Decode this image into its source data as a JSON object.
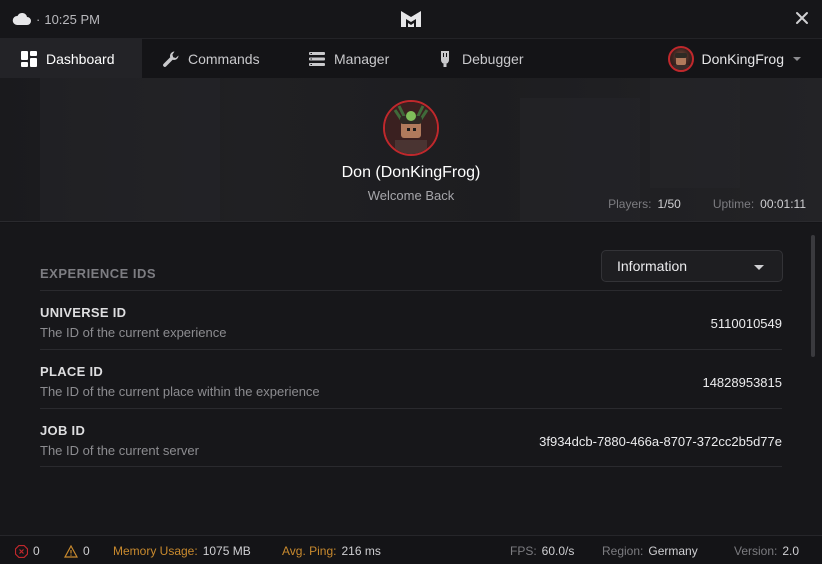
{
  "titlebar": {
    "time": "10:25 PM",
    "icons": {
      "weather": "cloud-icon",
      "logo": "logo-icon",
      "close": "close-icon"
    }
  },
  "nav": {
    "tabs": [
      {
        "label": "Dashboard",
        "icon": "dashboard-icon",
        "active": true
      },
      {
        "label": "Commands",
        "icon": "wrench-icon",
        "active": false
      },
      {
        "label": "Manager",
        "icon": "list-icon",
        "active": false
      },
      {
        "label": "Debugger",
        "icon": "debugger-icon",
        "active": false
      }
    ],
    "user": {
      "name": "DonKingFrog",
      "icon": "chevron-down-icon"
    }
  },
  "hero": {
    "display_name": "Don (DonKingFrog)",
    "welcome": "Welcome Back",
    "players_label": "Players:",
    "players_value": "1/50",
    "uptime_label": "Uptime:",
    "uptime_value": "00:01:11"
  },
  "main": {
    "section_title": "EXPERIENCE IDS",
    "dropdown": {
      "selected": "Information"
    },
    "rows": [
      {
        "title": "UNIVERSE ID",
        "desc": "The ID of the current experience",
        "value": "5110010549"
      },
      {
        "title": "PLACE ID",
        "desc": "The ID of the current place within the experience",
        "value": "14828953815"
      },
      {
        "title": "JOB ID",
        "desc": "The ID of the current server",
        "value": "3f934dcb-7880-466a-8707-372cc2b5d77e"
      }
    ]
  },
  "status": {
    "errors": "0",
    "warnings": "0",
    "memory_label": "Memory Usage:",
    "memory_value": "1075 MB",
    "ping_label": "Avg. Ping:",
    "ping_value": "216 ms",
    "fps_label": "FPS:",
    "fps_value": "60.0/s",
    "region_label": "Region:",
    "region_value": "Germany",
    "version_label": "Version:",
    "version_value": "2.0",
    "colors": {
      "error": "#c0282c",
      "warning": "#c98a2e"
    }
  }
}
